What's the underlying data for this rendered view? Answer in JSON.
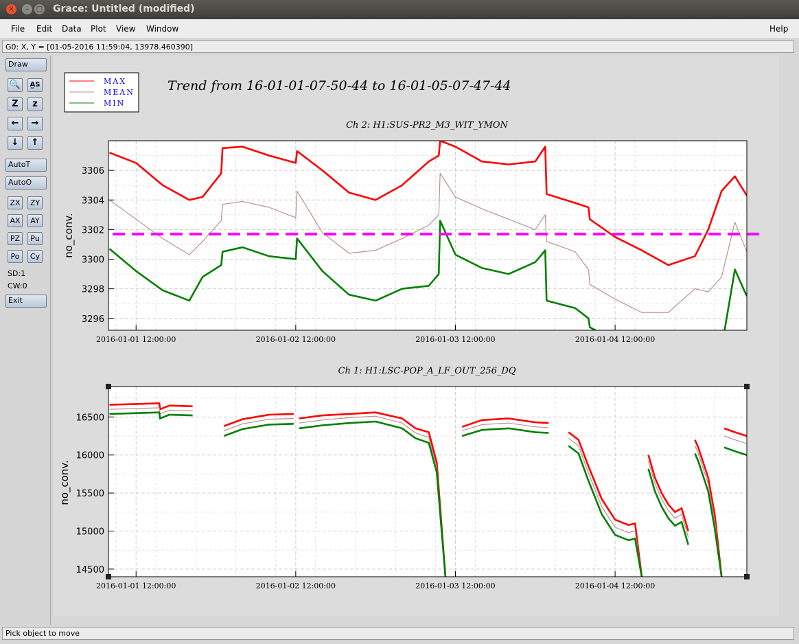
{
  "window": {
    "title": "Grace: Untitled (modified)",
    "close_icon": "×",
    "min_icon": "–",
    "max_icon": "□"
  },
  "menubar": {
    "file": "File",
    "edit": "Edit",
    "data": "Data",
    "plot": "Plot",
    "view": "View",
    "window": "Window",
    "help": "Help"
  },
  "locator": "G0: X, Y = [01-05-2016 11:59:04, 13978.460390]",
  "toolbar": {
    "draw": "Draw",
    "zoom_glyph": "🔍",
    "autoscale_glyph": "A̲S",
    "zoom_in": "Z",
    "zoom_out": "z",
    "left": "←",
    "right": "→",
    "down": "↓",
    "up": "↑",
    "autot": "AutoT",
    "autoo": "AutoO",
    "zx": "ZX",
    "zy": "ZY",
    "ax": "AX",
    "ay": "AY",
    "pz": "PZ",
    "pu": "Pu",
    "po": "Po",
    "cy": "Cy",
    "sd": "SD:1",
    "cw": "CW:0",
    "exit": "Exit"
  },
  "status": "Pick object to move",
  "plot": {
    "title": "Trend from 16-01-01-07-50-44 to 16-01-05-07-47-44",
    "legend": [
      {
        "name": "MAX",
        "color": "#ff0000"
      },
      {
        "name": "MEAN",
        "color": "#bc8f8f"
      },
      {
        "name": "MIN",
        "color": "#008000"
      }
    ],
    "reference_color": "#ff00ff"
  },
  "chart_data": [
    {
      "type": "line",
      "title": "Ch 2: H1:SUS-PR2_M3_WIT_YMON",
      "ylabel": "no_conv.",
      "xticks": [
        "2016-01-01 12:00:00",
        "2016-01-02 12:00:00",
        "2016-01-03 12:00:00",
        "2016-01-04 12:00:00"
      ],
      "yticks": [
        3296,
        3298,
        3300,
        3302,
        3304,
        3306
      ],
      "xlim_hours": [
        -4.15,
        91.8
      ],
      "ylim": [
        3295.2,
        3308
      ],
      "grid": true,
      "reference_line": 3301.7,
      "series": [
        {
          "name": "MAX",
          "x": [
            -4,
            0,
            4,
            8,
            10,
            12.8,
            13,
            16,
            20,
            24,
            24.2,
            28,
            32,
            36,
            40,
            44,
            45.5,
            45.7,
            48,
            52,
            56,
            60,
            61.5,
            61.7,
            66,
            68,
            68.2,
            72,
            76,
            80,
            84,
            86,
            88,
            90,
            91.8
          ],
          "y": [
            3307.2,
            3306.5,
            3305,
            3304,
            3304.2,
            3305.8,
            3307.5,
            3307.6,
            3307,
            3306.5,
            3307.3,
            3306,
            3304.5,
            3304,
            3305,
            3306.6,
            3307,
            3308,
            3307.6,
            3306.6,
            3306.4,
            3306.6,
            3307.6,
            3304.4,
            3303.8,
            3303.5,
            3302.7,
            3301.5,
            3300.6,
            3299.6,
            3300.2,
            3302,
            3304.6,
            3305.6,
            3304.3
          ]
        },
        {
          "name": "MEAN",
          "x": [
            -4,
            0,
            4,
            8,
            10,
            12.8,
            13,
            16,
            20,
            24,
            24.2,
            28,
            32,
            36,
            40,
            44,
            45.5,
            45.7,
            48,
            52,
            56,
            60,
            61.5,
            61.7,
            66,
            68,
            68.2,
            72,
            76,
            80,
            84,
            86,
            88,
            90,
            91.8
          ],
          "y": [
            3304,
            3302.7,
            3301.4,
            3300.3,
            3301.2,
            3302.6,
            3303.7,
            3303.9,
            3303.5,
            3302.8,
            3304.6,
            3301.8,
            3300.4,
            3300.6,
            3301.4,
            3302.3,
            3303,
            3305.8,
            3304.2,
            3303.4,
            3302.7,
            3302,
            3303,
            3301.2,
            3300.5,
            3299.3,
            3298.3,
            3297.3,
            3296.4,
            3296.4,
            3298,
            3297.8,
            3298.8,
            3302.5,
            3300.5
          ]
        },
        {
          "name": "MIN",
          "x": [
            -4,
            0,
            4,
            8,
            10,
            12.8,
            13,
            16,
            20,
            24,
            24.2,
            28,
            32,
            36,
            40,
            44,
            45.5,
            45.7,
            48,
            52,
            56,
            60,
            61.5,
            61.7,
            66,
            68,
            68.2,
            72,
            76,
            80,
            84,
            86,
            88,
            90,
            91.8
          ],
          "y": [
            3300.7,
            3299.2,
            3297.9,
            3297.2,
            3298.8,
            3299.6,
            3300.5,
            3300.8,
            3300.2,
            3300,
            3301.4,
            3299.2,
            3297.6,
            3297.2,
            3298,
            3298.2,
            3299,
            3302.6,
            3300.3,
            3299.4,
            3299,
            3299.8,
            3300.6,
            3297.2,
            3296.7,
            3296,
            3295.4,
            3294.5,
            3293.5,
            3293.5,
            3294,
            3294,
            3294,
            3299.3,
            3297.5
          ]
        }
      ]
    },
    {
      "type": "line",
      "title": "Ch 1: H1:LSC-POP_A_LF_OUT_256_DQ",
      "ylabel": "no_conv.",
      "xticks": [
        "2016-01-01 12:00:00",
        "2016-01-02 12:00:00",
        "2016-01-03 12:00:00",
        "2016-01-04 12:00:00"
      ],
      "yticks": [
        14500,
        15000,
        15500,
        16000,
        16500
      ],
      "xlim_hours": [
        -4.15,
        91.8
      ],
      "ylim": [
        14400,
        16900
      ],
      "grid": true,
      "series": [
        {
          "name": "MAX",
          "x": [
            -4,
            3.5,
            3.6,
            5,
            8.5,
            null,
            13.2,
            16,
            20,
            23.7,
            null,
            24.5,
            28,
            32,
            36,
            40,
            42,
            44,
            45.2,
            46.5,
            null,
            49,
            52,
            56,
            60,
            62,
            null,
            65,
            66.5,
            68,
            70,
            72,
            74,
            75,
            76,
            null,
            77,
            78,
            79,
            80,
            81,
            82,
            83,
            null,
            84,
            84.5,
            86,
            87,
            88,
            null,
            88.4,
            90,
            91.8
          ],
          "y": [
            16660,
            16680,
            16600,
            16650,
            16640,
            null,
            16380,
            16470,
            16530,
            16540,
            null,
            16480,
            16520,
            16540,
            16560,
            16480,
            16350,
            16300,
            15900,
            14400,
            null,
            16370,
            16460,
            16480,
            16430,
            16420,
            null,
            16300,
            16200,
            15850,
            15420,
            15150,
            15080,
            15100,
            14400,
            null,
            16000,
            15700,
            15500,
            15350,
            15250,
            15300,
            15000,
            null,
            16200,
            16100,
            15700,
            15200,
            14400,
            null,
            16350,
            16300,
            16250
          ]
        },
        {
          "name": "MEAN",
          "x": [
            -4,
            3.5,
            3.6,
            5,
            8.5,
            null,
            13.2,
            16,
            20,
            23.7,
            null,
            24.5,
            28,
            32,
            36,
            40,
            42,
            44,
            45.2,
            46.5,
            null,
            49,
            52,
            56,
            60,
            62,
            null,
            65,
            66.5,
            68,
            70,
            72,
            74,
            75,
            76,
            null,
            77,
            78,
            79,
            80,
            81,
            82,
            83,
            null,
            84,
            84.5,
            86,
            87,
            88,
            null,
            88.4,
            90,
            91.8
          ],
          "y": [
            16600,
            16620,
            16540,
            16590,
            16580,
            null,
            16320,
            16410,
            16470,
            16480,
            null,
            16420,
            16460,
            16490,
            16510,
            16420,
            16290,
            16230,
            15840,
            14400,
            null,
            16320,
            16400,
            16420,
            16370,
            16360,
            null,
            16220,
            16120,
            15760,
            15320,
            15050,
            14980,
            15000,
            14400,
            null,
            15920,
            15620,
            15420,
            15270,
            15170,
            15220,
            14920,
            null,
            16120,
            16020,
            15620,
            15120,
            14400,
            null,
            16250,
            16200,
            16150
          ]
        },
        {
          "name": "MIN",
          "x": [
            -4,
            3.5,
            3.6,
            5,
            8.5,
            null,
            13.2,
            16,
            20,
            23.7,
            null,
            24.5,
            28,
            32,
            36,
            40,
            42,
            44,
            45.2,
            46.5,
            null,
            49,
            52,
            56,
            60,
            62,
            null,
            65,
            66.5,
            68,
            70,
            72,
            74,
            75,
            76,
            null,
            77,
            78,
            79,
            80,
            81,
            82,
            83,
            null,
            84,
            84.5,
            86,
            87,
            88,
            null,
            88.4,
            90,
            91.8
          ],
          "y": [
            16540,
            16560,
            16480,
            16530,
            16520,
            null,
            16250,
            16340,
            16400,
            16410,
            null,
            16350,
            16390,
            16420,
            16440,
            16350,
            16220,
            16160,
            15770,
            14400,
            null,
            16250,
            16330,
            16350,
            16300,
            16290,
            null,
            16120,
            16020,
            15660,
            15220,
            14950,
            14880,
            14900,
            14400,
            null,
            15820,
            15520,
            15320,
            15170,
            15070,
            15120,
            14820,
            null,
            16020,
            15920,
            15520,
            15020,
            14400,
            null,
            16100,
            16050,
            16000
          ]
        }
      ]
    }
  ]
}
